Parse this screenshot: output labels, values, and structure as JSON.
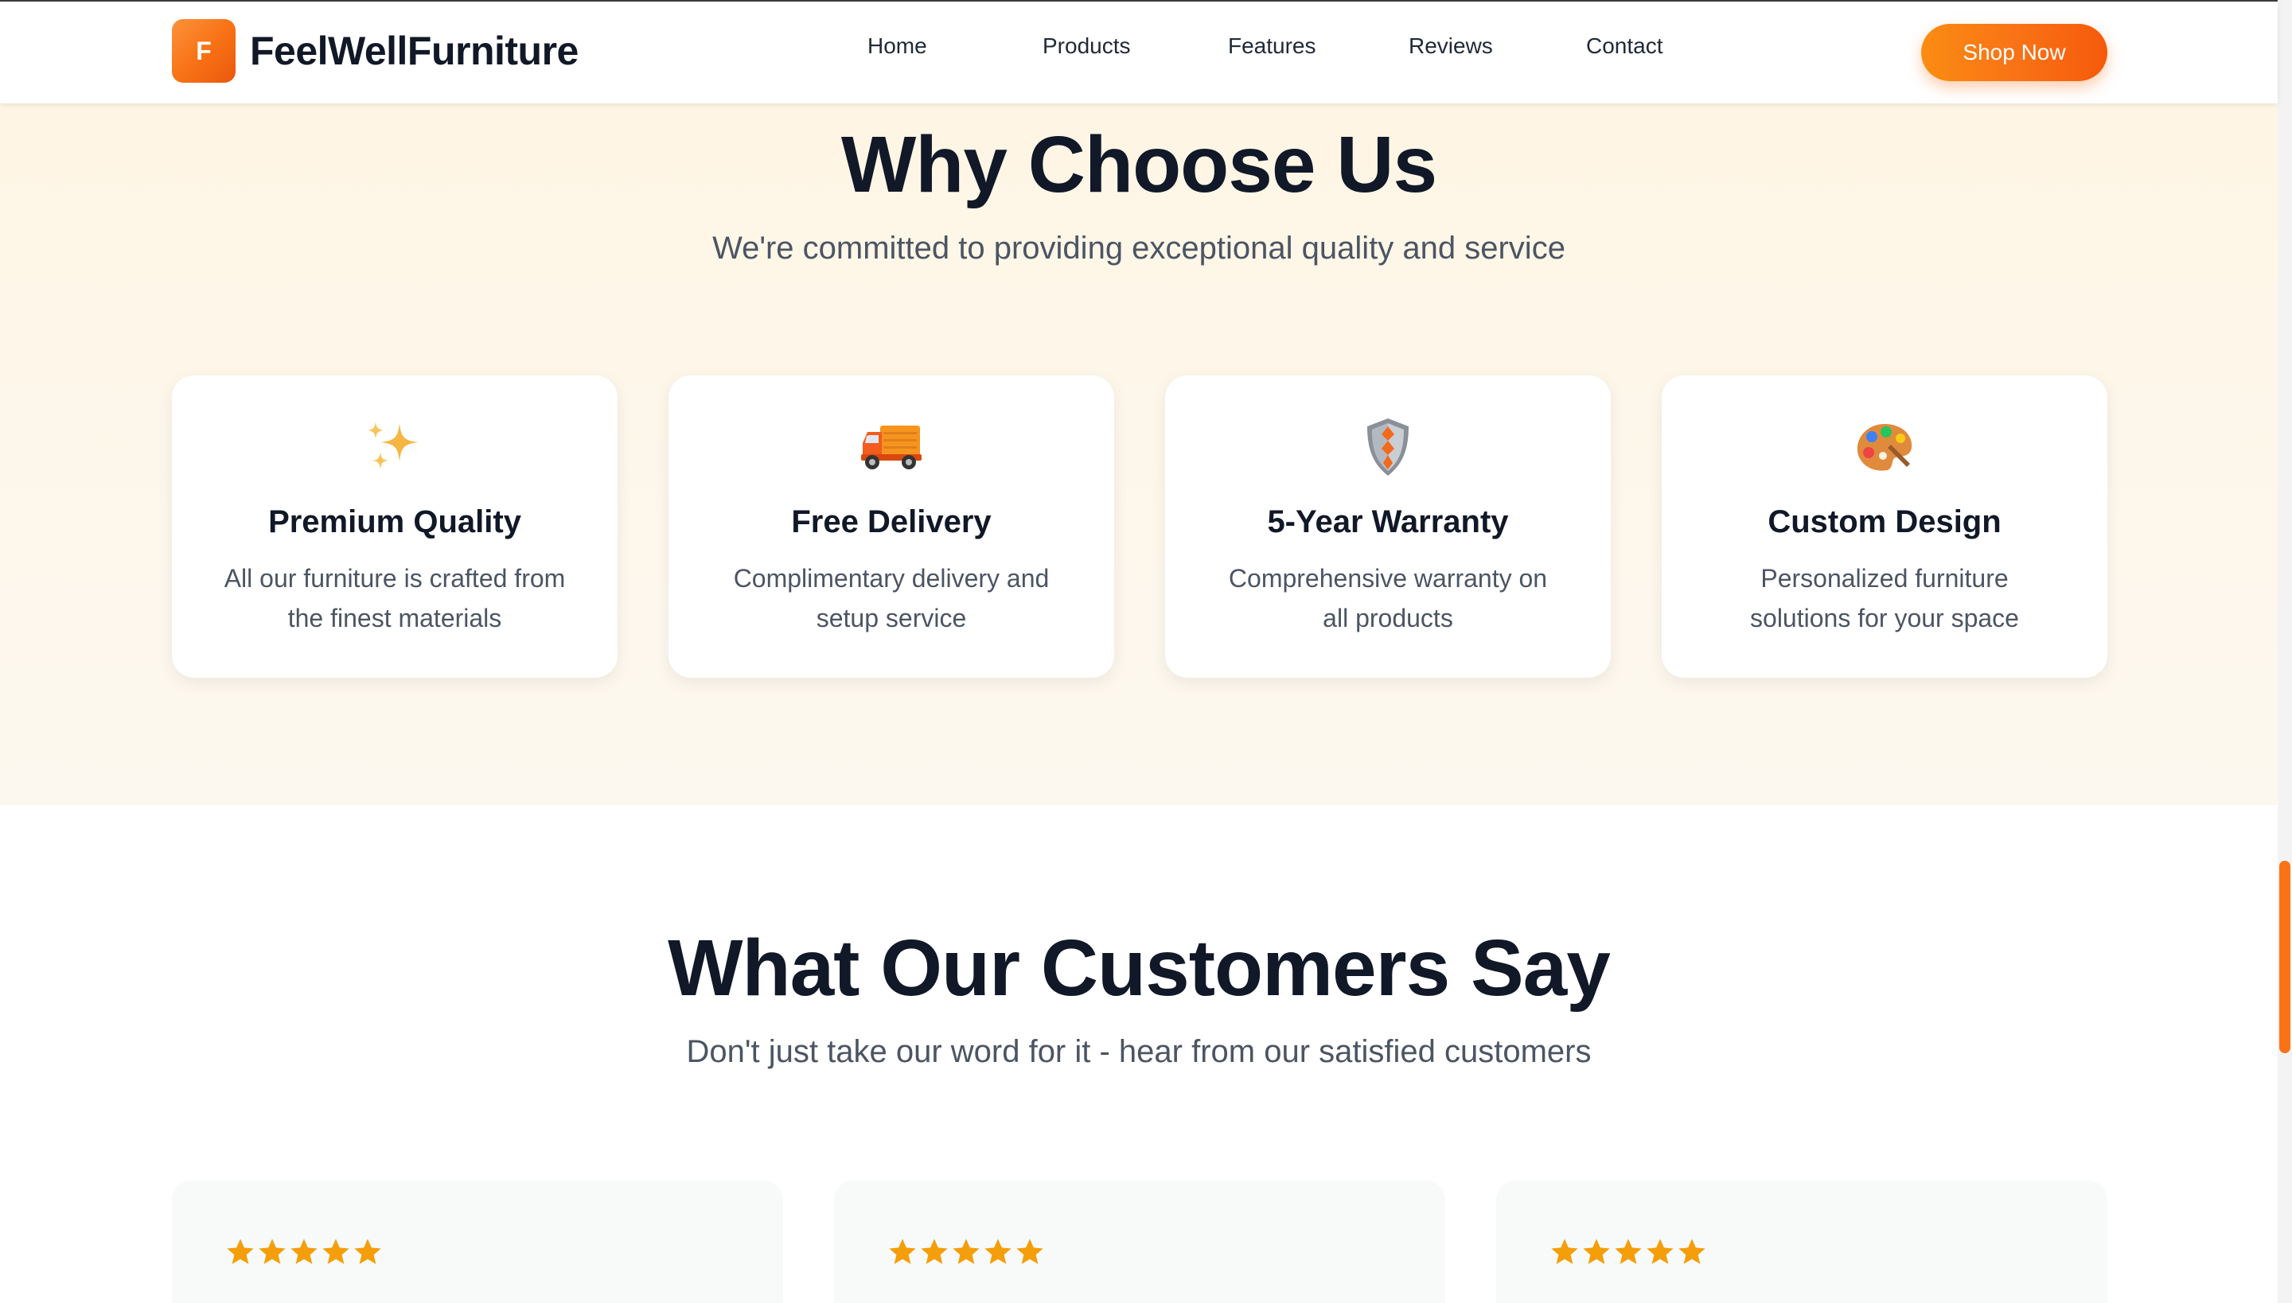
{
  "nav": {
    "logo_letter": "F",
    "brand": "FeelWellFurniture",
    "links": [
      "Home",
      "Products",
      "Features",
      "Reviews",
      "Contact"
    ],
    "cta": "Shop Now"
  },
  "why": {
    "title": "Why Choose Us",
    "subtitle": "We're committed to providing exceptional quality and service",
    "features": [
      {
        "icon": "sparkles-icon",
        "title": "Premium Quality",
        "desc": "All our furniture is crafted from the finest materials"
      },
      {
        "icon": "delivery-truck-icon",
        "title": "Free Delivery",
        "desc": "Complimentary delivery and setup service"
      },
      {
        "icon": "shield-icon",
        "title": "5-Year Warranty",
        "desc": "Comprehensive warranty on all products"
      },
      {
        "icon": "palette-icon",
        "title": "Custom Design",
        "desc": "Personalized furniture solutions for your space"
      }
    ]
  },
  "testimonials": {
    "title": "What Our Customers Say",
    "subtitle": "Don't just take our word for it - hear from our satisfied customers",
    "reviews": [
      {
        "rating": 5
      },
      {
        "rating": 5
      },
      {
        "rating": 5
      }
    ]
  },
  "colors": {
    "accent": "#f97316",
    "star": "#f59e0b",
    "section_bg": "#fef5e4"
  }
}
